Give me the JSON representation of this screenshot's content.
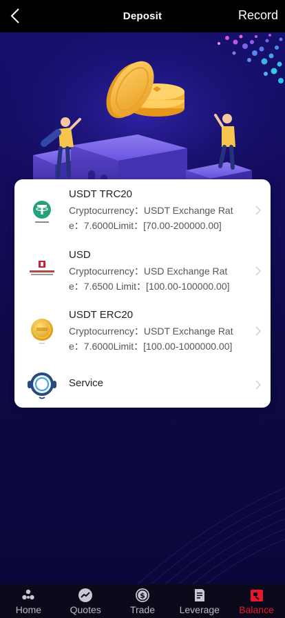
{
  "header": {
    "title": "Deposit",
    "record_label": "Record",
    "back_icon": "chevron-left-icon"
  },
  "methods": [
    {
      "name": "USDT TRC20",
      "desc_line1": "Cryptocurrency：USDT Exchange Rat",
      "desc_line2": "e：7.6000Limit：[70.00-200000.00]",
      "icon": "tether-logo-icon"
    },
    {
      "name": "USD",
      "desc_line1": "Cryptocurrency：USD Exchange Rat",
      "desc_line2": "e：7.6500 Limit：[100.00-100000.00]",
      "icon": "bank-logo-icon"
    },
    {
      "name": "USDT ERC20",
      "desc_line1": "Cryptocurrency：USDT Exchange Rat",
      "desc_line2": "e：7.6000Limit：[100.00-1000000.00]",
      "icon": "gold-coin-icon"
    }
  ],
  "service": {
    "label": "Service",
    "icon": "headset-icon"
  },
  "tabs": [
    {
      "label": "Home",
      "icon": "home-icon",
      "active": false
    },
    {
      "label": "Quotes",
      "icon": "quotes-icon",
      "active": false
    },
    {
      "label": "Trade",
      "icon": "dollar-coin-icon",
      "active": false
    },
    {
      "label": "Leverage",
      "icon": "document-icon",
      "active": false
    },
    {
      "label": "Balance",
      "icon": "wallet-icon",
      "active": true
    }
  ],
  "colors": {
    "active_tab": "#e8182c",
    "inactive_tab": "#b8b8c4",
    "header_bg": "#000000",
    "page_bg": "#130c5c"
  }
}
